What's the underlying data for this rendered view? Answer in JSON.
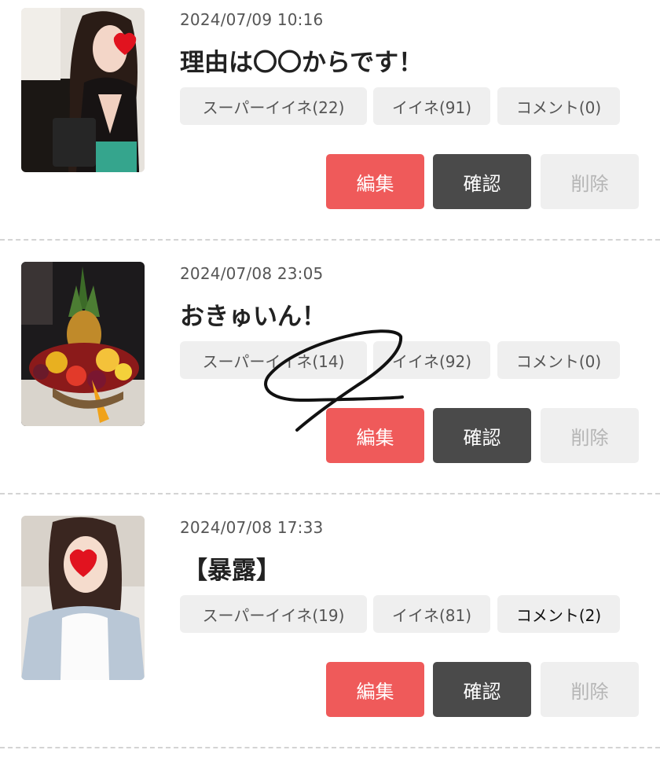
{
  "posts": [
    {
      "timestamp": "2024/07/09 10:16",
      "title": "理由は〇〇からです！",
      "super_like": "スーパーイイネ(22)",
      "like": "イイネ(91)",
      "comment": "コメント(0)",
      "edit": "編集",
      "confirm": "確認",
      "delete": "削除"
    },
    {
      "timestamp": "2024/07/08 23:05",
      "title": "おきゅいん！",
      "super_like": "スーパーイイネ(14)",
      "like": "イイネ(92)",
      "comment": "コメント(0)",
      "edit": "編集",
      "confirm": "確認",
      "delete": "削除"
    },
    {
      "timestamp": "2024/07/08 17:33",
      "title": "【暴露】",
      "super_like": "スーパーイイネ(19)",
      "like": "イイネ(81)",
      "comment": "コメント(2)",
      "edit": "編集",
      "confirm": "確認",
      "delete": "削除"
    }
  ],
  "colors": {
    "edit": "#ef5a5a",
    "confirm": "#4a4a4a",
    "delete_bg": "#efefef",
    "tag_bg": "#efefef"
  }
}
